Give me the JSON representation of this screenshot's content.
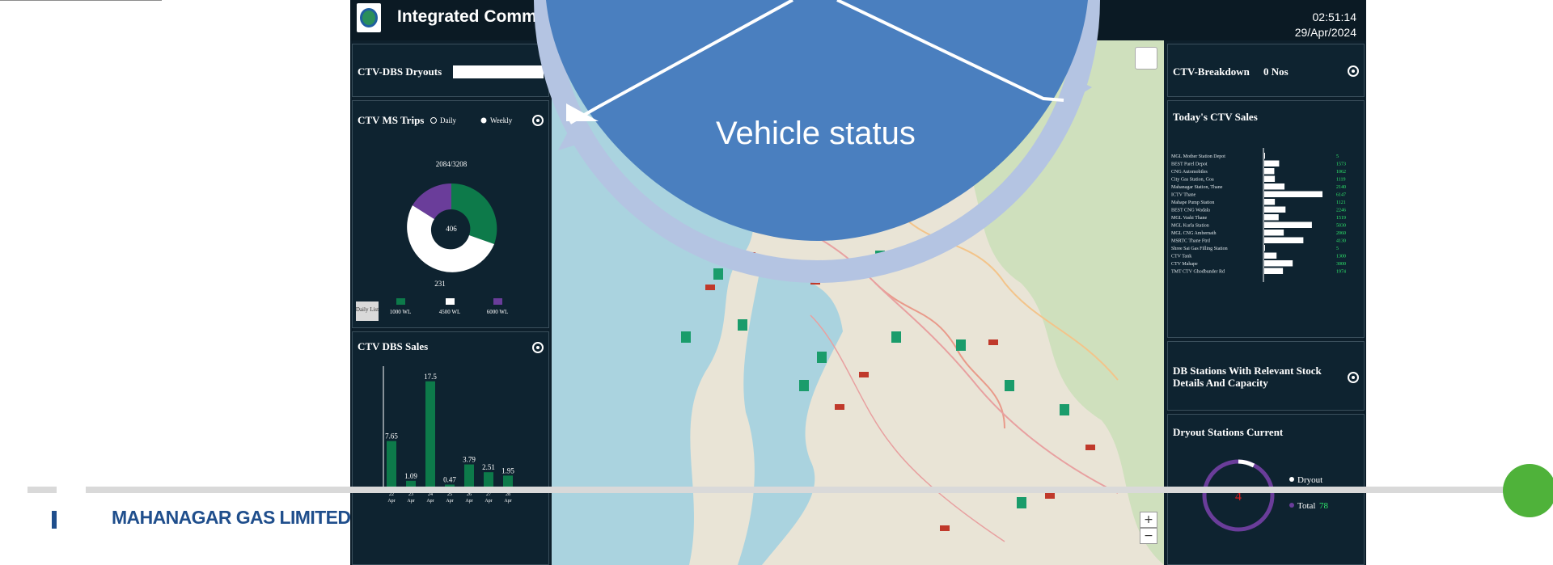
{
  "dashboard": {
    "title": "Integrated Command Center – CTV Dashboard",
    "time": "02:51:14",
    "date": "29/Apr/2024"
  },
  "panels": {
    "dryouts": {
      "title": "CTV-DBS Dryouts"
    },
    "ms_trips": {
      "title": "CTV MS Trips",
      "option_daily": "Daily",
      "option_weekly": "Weekly",
      "top_value": "2084/3208",
      "center_value": "406",
      "bottom_value": "231",
      "legend": [
        "1000 WL",
        "4500 WL",
        "6000 WL"
      ],
      "side_label": "Daily List",
      "colors": {
        "green": "#0d7a4a",
        "white": "#ffffff",
        "purple": "#6a3d9a"
      }
    },
    "dbs_sales": {
      "title": "CTV DBS Sales",
      "chart_data": {
        "type": "bar",
        "categories": [
          "22 Apr",
          "23 Apr",
          "24 Apr",
          "25 Apr",
          "26 Apr",
          "27 Apr",
          "28 Apr"
        ],
        "values": [
          7.65,
          1.09,
          17.5,
          0.47,
          3.79,
          2.51,
          1.95
        ],
        "value_labels": [
          "7.65",
          "1.09",
          "17.5",
          "0.47",
          "3.79",
          "2.51",
          "1.95"
        ],
        "ylim": [
          0,
          20
        ],
        "color": "#0d7a4a"
      }
    },
    "breakdown": {
      "title": "CTV-Breakdown",
      "value": "0 Nos"
    },
    "todays_sales": {
      "title": "Today's CTV Sales",
      "chart_data": {
        "type": "bar",
        "categories": [
          "MGL Mother Station Depot",
          "BEST Parel Depot",
          "CNG Automobiles",
          "City Gas Station, Goa",
          "Mahanagar Station, Thane",
          "ICTV Thane",
          "Mahape Pump Station",
          "BEST CNG Wadala",
          "MGL Vashi Thane",
          "MGL Kurla Station",
          "MGL CNG Ambernath",
          "MSRTC Thane Ftrd",
          "Shree Sai Gas Filling Station",
          "CTV Tank",
          "CTV Mahape",
          "TMT CTV Ghodbunder Rd"
        ],
        "values": [
          5,
          1573,
          1062,
          1119,
          2140,
          6147,
          1121,
          2246,
          1519,
          5030,
          2060,
          4130,
          5,
          1300,
          3000,
          1974
        ],
        "color": "#ffffff"
      }
    },
    "db_stations": {
      "title": "DB Stations With Relevant Stock Details And Capacity"
    },
    "dryout_current": {
      "title": "Dryout Stations Current",
      "count": "4",
      "legend_dryout": "Dryout",
      "legend_total_label": "Total",
      "legend_total_value": "78"
    }
  },
  "map": {
    "zoom_in": "+",
    "zoom_out": "−"
  },
  "callout": {
    "label": "Vehicle status",
    "fill": "#4a7fbf",
    "ring": "#b4c4e2"
  },
  "footer": {
    "company": "MAHANAGAR GAS LIMITED"
  }
}
